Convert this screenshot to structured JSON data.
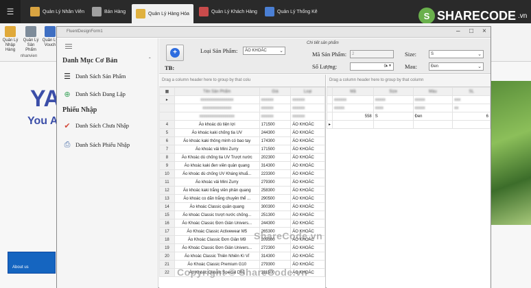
{
  "ribbon": {
    "tabs": [
      {
        "label": "Quản Lý Nhân Viên"
      },
      {
        "label": "Bán Hàng"
      },
      {
        "label": "Quản Lý Hàng Hóa"
      },
      {
        "label": "Quản Lý Khách Hàng"
      },
      {
        "label": "Quản Lý Thống Kê"
      }
    ],
    "buttons": [
      {
        "label": "Quản Lý Nhập Hàng"
      },
      {
        "label": "Quản Lý Sản Phẩm"
      },
      {
        "label": "Quản Lý Vouch"
      }
    ],
    "group_label": "nhanvien"
  },
  "background": {
    "big_text": "YA",
    "you_text": "You A",
    "about_label": "About us",
    "logo_text": "SHARECODE",
    "logo_suffix": ".vn"
  },
  "form": {
    "title": "FluentDesignForm1",
    "sidebar": {
      "group1": "Danh Mục Cơ Bản",
      "item1": "Danh Sách Sản Phẩm",
      "item2": "Danh Sách Đang Lập",
      "group2": "Phiếu Nhập",
      "item3": "Danh Sách Chưa Nhập",
      "item4": "Danh Sách Phiếu Nhập"
    },
    "top": {
      "tb_label": "TB:",
      "loai_sp_label": "Loại Sản Phẩm:",
      "loai_sp_value": "ÁO KHOÁC",
      "legend": "Chi tiết sản phẩm",
      "ma_sp_label": "Mã Sản Phẩm:",
      "ma_sp_value": "2",
      "so_luong_label": "Số Lượng:",
      "so_luong_value": "0",
      "size_label": "Size:",
      "size_value": "S",
      "mau_label": "Mau:",
      "mau_value": "Đen"
    },
    "left_grid": {
      "group_hint": "Drag a column header here to group by that colu",
      "rows": [
        {
          "n": "4",
          "name": "Áo khoác dù tiện lợi",
          "price": "171500",
          "type": "ÁO KHOÁC"
        },
        {
          "n": "5",
          "name": "Áo khoác kaki chống tia UV",
          "price": "244300",
          "type": "ÁO KHOÁC"
        },
        {
          "n": "6",
          "name": "Áo khoác kaki thông minh có bao tay",
          "price": "174300",
          "type": "ÁO KHOÁC"
        },
        {
          "n": "7",
          "name": "Áo khoác vải Mini Zurry",
          "price": "171500",
          "type": "ÁO KHOÁC"
        },
        {
          "n": "8",
          "name": "Áo Khoác dù chống tia UV Trượt nước",
          "price": "202300",
          "type": "ÁO KHOÁC"
        },
        {
          "n": "9",
          "name": "Áo khoác kaki đen viền quân quang",
          "price": "314300",
          "type": "ÁO KHOÁC"
        },
        {
          "n": "10",
          "name": "Áo khoác dù chống UV Kháng khuẩ...",
          "price": "223300",
          "type": "ÁO KHOÁC"
        },
        {
          "n": "11",
          "name": "Áo khoác vải Mini Zurry",
          "price": "279300",
          "type": "ÁO KHOÁC"
        },
        {
          "n": "12",
          "name": "Áo khoác kaki trắng viền phản quang",
          "price": "258300",
          "type": "ÁO KHOÁC"
        },
        {
          "n": "13",
          "name": "Áo khoác co dãn trắng chuyên thể ...",
          "price": "290500",
          "type": "ÁO KHOÁC"
        },
        {
          "n": "14",
          "name": "Áo khoác Classic quân quang",
          "price": "300300",
          "type": "ÁO KHOÁC"
        },
        {
          "n": "15",
          "name": "Áo khoác Classic trượt nước chống...",
          "price": "251300",
          "type": "ÁO KHOÁC"
        },
        {
          "n": "16",
          "name": "Áo Khoác Classic Đơn Giản Univers...",
          "price": "244300",
          "type": "ÁO KHOÁC"
        },
        {
          "n": "17",
          "name": "Áo Khoác Classic Activewear M5",
          "price": "265300",
          "type": "ÁO KHOÁC"
        },
        {
          "n": "18",
          "name": "Áo Khoác Classic Đơn Giản M9",
          "price": "209300",
          "type": "ÁO KHOÁC"
        },
        {
          "n": "19",
          "name": "Áo Khoác Classic Đơn Giản Univers...",
          "price": "272300",
          "type": "ÁO KHOÁC"
        },
        {
          "n": "20",
          "name": "Áo khoác Classic Thiên Nhiên Kì Vĩ",
          "price": "314300",
          "type": "ÁO KHOÁC"
        },
        {
          "n": "21",
          "name": "Áo Khoác Classic Premium G10",
          "price": "279300",
          "type": "ÁO KHOÁC"
        },
        {
          "n": "22",
          "name": "Áo Khoác Classic Special D03",
          "price": "311500",
          "type": "ÁO KHOÁC"
        }
      ]
    },
    "right_grid": {
      "group_hint": "Drag a column header here to group by that column",
      "row": {
        "id": "558",
        "size": "S",
        "color": "Đen",
        "qty": "6"
      }
    }
  },
  "watermarks": {
    "center": "ShareCode.vn",
    "bottom": "Copyright © ShareCode.vn"
  },
  "colors": {
    "accent": "#2d6cdf",
    "about_bg": "#1565c0",
    "logo_green": "#6ab04c",
    "brand_blue": "#3b4ea8"
  }
}
